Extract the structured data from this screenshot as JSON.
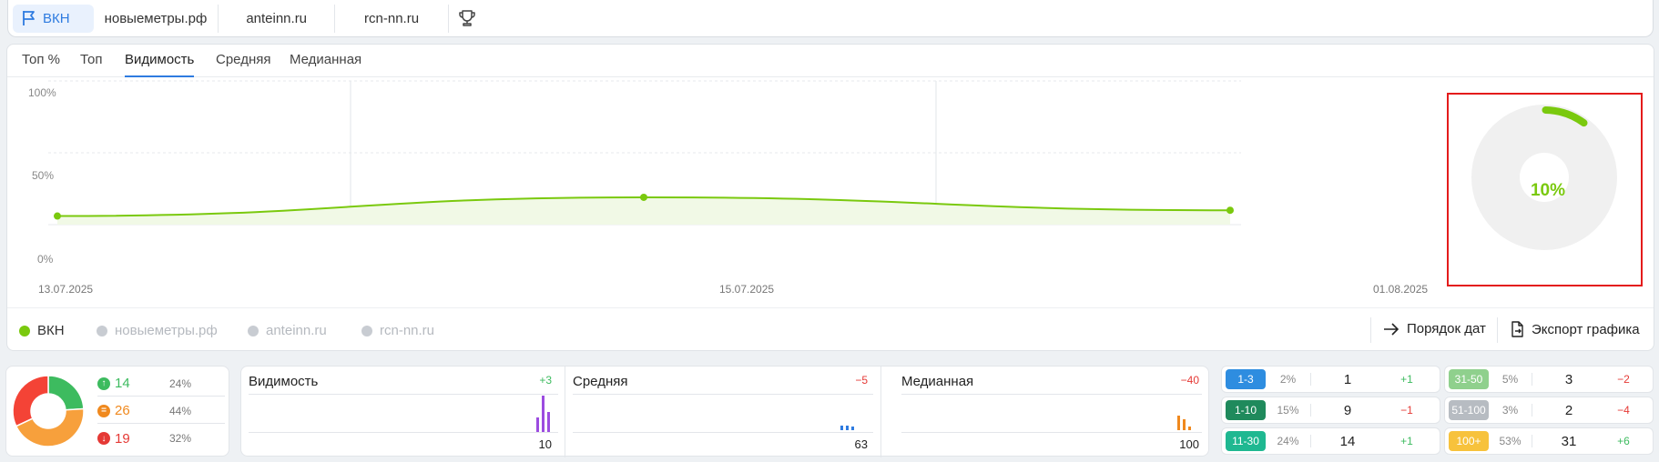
{
  "projects": [
    {
      "label": "ВКН",
      "active": true
    },
    {
      "label": "новыеметры.рф",
      "active": false
    },
    {
      "label": "anteinn.ru",
      "active": false
    },
    {
      "label": "rcn-nn.ru",
      "active": false
    }
  ],
  "tabs": [
    "Топ %",
    "Топ",
    "Видимость",
    "Средняя",
    "Медианная"
  ],
  "active_tab": "Видимость",
  "chart_data": {
    "type": "area",
    "x": [
      "13.07.2025",
      "15.07.2025",
      "01.08.2025"
    ],
    "series": [
      {
        "name": "ВКН",
        "values": [
          6,
          19,
          10
        ],
        "color": "#7ac90e"
      }
    ],
    "yticks": [
      "100%",
      "50%",
      "0%"
    ],
    "ylim": [
      0,
      100
    ],
    "grid": true
  },
  "gauge": {
    "value": 10,
    "label": "10%",
    "color": "#7ac90e"
  },
  "legend": [
    {
      "label": "ВКН",
      "color": "#7ac90e",
      "active": true
    },
    {
      "label": "новыеметры.рф",
      "color": "#c8ccd2",
      "active": false
    },
    {
      "label": "anteinn.ru",
      "color": "#c8ccd2",
      "active": false
    },
    {
      "label": "rcn-nn.ru",
      "color": "#c8ccd2",
      "active": false
    }
  ],
  "actions": {
    "date_order": "Порядок дат",
    "export": "Экспорт графика"
  },
  "trend": {
    "pie": [
      {
        "value": 24,
        "color": "#3dbb5f"
      },
      {
        "value": 44,
        "color": "#f7a03c"
      },
      {
        "value": 32,
        "color": "#f44336"
      }
    ],
    "up": {
      "count": "14",
      "pct": "24%"
    },
    "same": {
      "count": "26",
      "pct": "44%"
    },
    "down": {
      "count": "19",
      "pct": "32%"
    }
  },
  "metrics": [
    {
      "title": "Видимость",
      "delta": "+3",
      "value": "10",
      "delta_color": "#3dbb5f",
      "bar_color": "#9c4ce0"
    },
    {
      "title": "Средняя",
      "delta": "−5",
      "value": "63",
      "delta_color": "#e53935",
      "bar_color": "#2e7be0"
    },
    {
      "title": "Медианная",
      "delta": "−40",
      "value": "100",
      "delta_color": "#e53935",
      "bar_color": "#f0891e"
    }
  ],
  "ranges_left": [
    {
      "label": "1-3",
      "pct": "2%",
      "count": "1",
      "delta": "+1",
      "color": "#2e8de0",
      "delta_color": "#3dbb5f"
    },
    {
      "label": "1-10",
      "pct": "15%",
      "count": "9",
      "delta": "−1",
      "color": "#1f8a5c",
      "delta_color": "#e53935"
    },
    {
      "label": "11-30",
      "pct": "24%",
      "count": "14",
      "delta": "+1",
      "color": "#1fb891",
      "delta_color": "#3dbb5f"
    }
  ],
  "ranges_right": [
    {
      "label": "31-50",
      "pct": "5%",
      "count": "3",
      "delta": "−2",
      "color": "#8fd08d",
      "delta_color": "#e53935"
    },
    {
      "label": "51-100",
      "pct": "3%",
      "count": "2",
      "delta": "−4",
      "color": "#b7bcc2",
      "delta_color": "#e53935"
    },
    {
      "label": "100+",
      "pct": "53%",
      "count": "31",
      "delta": "+6",
      "color": "#f7c23c",
      "delta_color": "#3dbb5f"
    }
  ]
}
